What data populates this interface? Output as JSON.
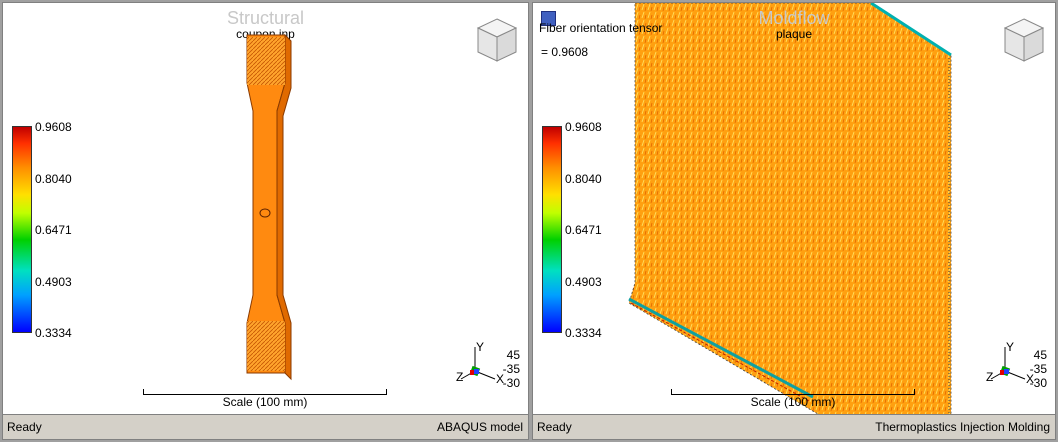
{
  "left_pane": {
    "watermark": "Structural",
    "file": "coupon.inp",
    "legend": [
      "0.9608",
      "0.8040",
      "0.6471",
      "0.4903",
      "0.3334"
    ],
    "scale": "Scale (100 mm)",
    "angles": [
      "45",
      "-35",
      "-30"
    ],
    "axes": {
      "y": "Y",
      "x": "X",
      "z": "Z"
    },
    "status": "Ready",
    "status_right": "ABAQUS model"
  },
  "right_pane": {
    "watermark": "Moldflow",
    "file": "plaque",
    "result_name": "Fiber orientation tensor",
    "result_value": "= 0.9608",
    "legend": [
      "0.9608",
      "0.8040",
      "0.6471",
      "0.4903",
      "0.3334"
    ],
    "scale": "Scale (100 mm)",
    "angles": [
      "45",
      "-35",
      "-30"
    ],
    "axes": {
      "y": "Y",
      "x": "X",
      "z": "Z"
    },
    "status": "Ready",
    "status_right": "Thermoplastics Injection Molding"
  },
  "colors": {
    "part_fill": "#ff8000",
    "mesh_fill": "#ffa020",
    "background": "#ffffff",
    "statusbar": "#d4d0c8"
  }
}
